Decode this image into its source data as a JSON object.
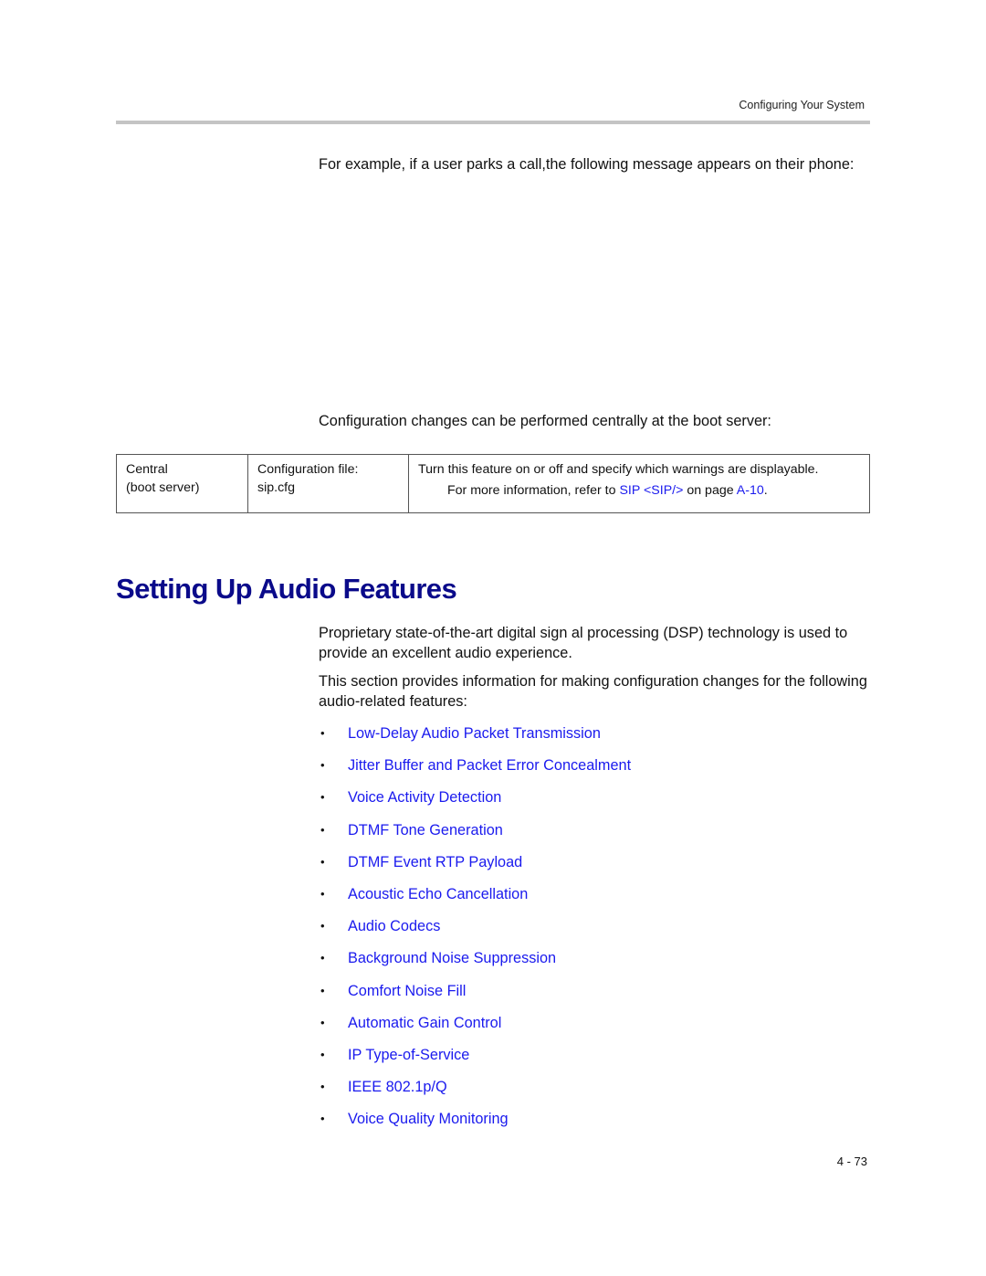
{
  "header": {
    "running_title": "Configuring Your System"
  },
  "body": {
    "intro_paragraph": "For example, if a user parks a call,the following message appears on their phone:",
    "config_paragraph": "Configuration changes can be performed centrally at the boot server:"
  },
  "config_table": {
    "rows": [
      {
        "location_line1": "Central",
        "location_line2": "(boot server)",
        "file_label": "Configuration file:",
        "file_name": "sip.cfg",
        "description": "Turn this feature on or off and specify which warnings are displayable.",
        "more_info_prefix": "For more information, refer to ",
        "more_info_link": "SIP <SIP/>",
        "more_info_middle": " on page ",
        "more_info_page_link": "A-10",
        "more_info_suffix": "."
      }
    ]
  },
  "section": {
    "title": "Setting Up Audio Features",
    "paragraph1": "Proprietary state-of-the-art digital sign al processing (DSP) technology is used to provide an excellent audio experience.",
    "paragraph2": "This section provides information for  making configuration changes for the following audio-related features:",
    "bullet_char": "•",
    "features": [
      "Low-Delay Audio Packet Transmission",
      "Jitter Buffer and Packet Error Concealment",
      "Voice Activity Detection",
      "DTMF Tone Generation",
      "DTMF Event RTP Payload",
      "Acoustic Echo Cancellation",
      "Audio Codecs",
      "Background Noise Suppression",
      "Comfort Noise Fill",
      "Automatic Gain Control",
      "IP Type-of-Service",
      "IEEE 802.1p/Q",
      "Voice Quality Monitoring"
    ]
  },
  "footer": {
    "page_number": "4 - 73"
  },
  "colors": {
    "link": "#1a1aee",
    "heading": "#0a0a8a",
    "header_rule": "#c4c4c4"
  }
}
